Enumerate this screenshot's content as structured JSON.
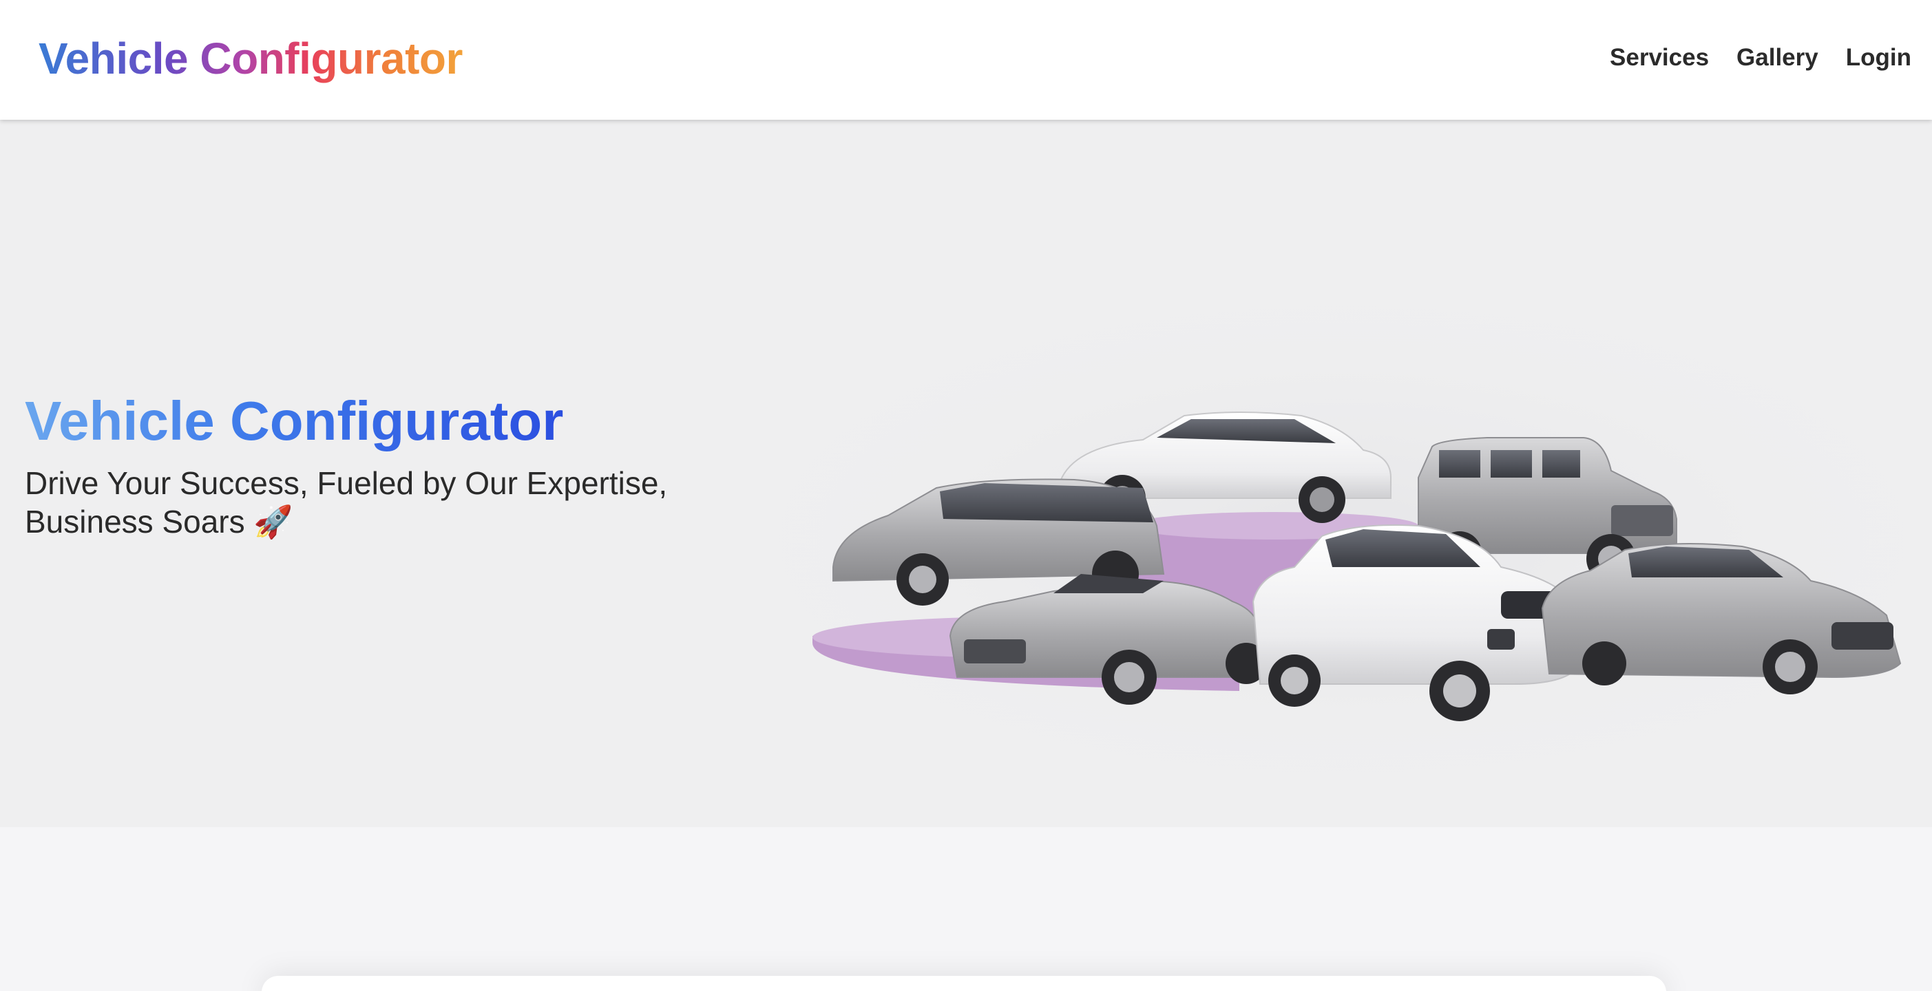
{
  "header": {
    "brand": "Vehicle Configurator",
    "nav": [
      {
        "label": "Services"
      },
      {
        "label": "Gallery"
      },
      {
        "label": "Login"
      }
    ]
  },
  "hero": {
    "title": "Vehicle Configurator",
    "subtitle_line1": "Drive Your Success, Fueled by Our Expertise,",
    "subtitle_line2": "Business Soars",
    "subtitle_emoji": "🚀",
    "image_alt": "Lineup of vehicles on podium"
  },
  "colors": {
    "podium": "#c19bcd",
    "hero_bg": "#efeff0",
    "page_bg": "#f5f5f7"
  }
}
